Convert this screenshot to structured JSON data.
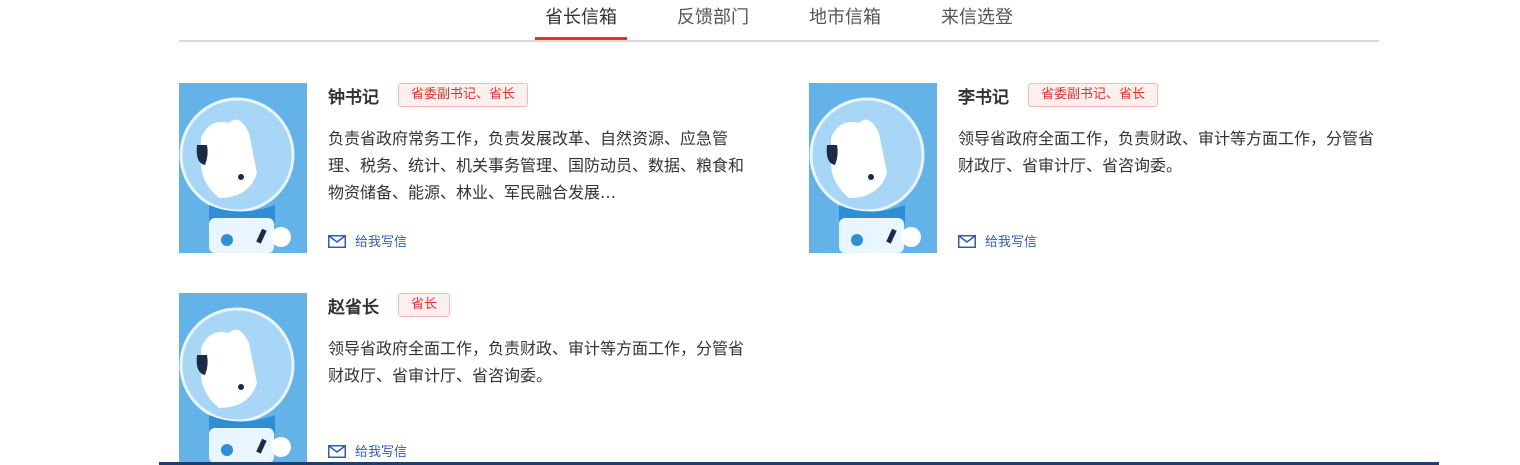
{
  "tabs": [
    {
      "label": "省长信箱",
      "active": true
    },
    {
      "label": "反馈部门",
      "active": false
    },
    {
      "label": "地市信箱",
      "active": false
    },
    {
      "label": "来信选登",
      "active": false
    }
  ],
  "leaders": [
    {
      "name": "钟书记",
      "title": "省委副书记、省长",
      "desc": "负责省政府常务工作，负责发展改革、自然资源、应急管理、税务、统计、机关事务管理、国防动员、数据、粮食和物资储备、能源、林业、军民融合发展…",
      "action": "给我写信"
    },
    {
      "name": "李书记",
      "title": "省委副书记、省长",
      "desc": "领导省政府全面工作，负责财政、审计等方面工作，分管省财政厅、省审计厅、省咨询委。",
      "action": "给我写信"
    },
    {
      "name": "赵省长",
      "title": "省长",
      "desc": "领导省政府全面工作，负责财政、审计等方面工作，分管省财政厅、省审计厅、省咨询委。",
      "action": "给我写信"
    }
  ],
  "colors": {
    "accent": "#e2322b",
    "link": "#2d5fb7",
    "avatar_bg": "#63b2e8"
  },
  "icons": {
    "mail": "mail-icon",
    "avatar": "mascot-avatar"
  }
}
